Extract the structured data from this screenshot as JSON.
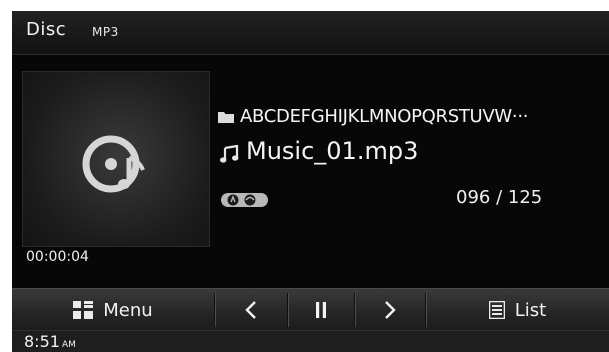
{
  "header": {
    "title": "Disc",
    "subtitle": "MP3"
  },
  "album_art": {
    "icon": "disc-music-icon"
  },
  "now_playing": {
    "folder": "ABCDEFGHIJKLMNOPQRSTUVW···",
    "file": "Music_01.mp3",
    "repeat_icon": "repeat-ab-icon",
    "track_count": "096 / 125",
    "elapsed": "00:00:04"
  },
  "controls": {
    "menu_label": "Menu",
    "list_label": "List",
    "prev_icon": "previous-icon",
    "pause_icon": "pause-icon",
    "next_icon": "next-icon"
  },
  "status": {
    "time": "8:51",
    "ampm": "AM"
  },
  "colors": {
    "background": "#070707",
    "text": "#f2f2f2",
    "bar": "#2a2a2a"
  }
}
